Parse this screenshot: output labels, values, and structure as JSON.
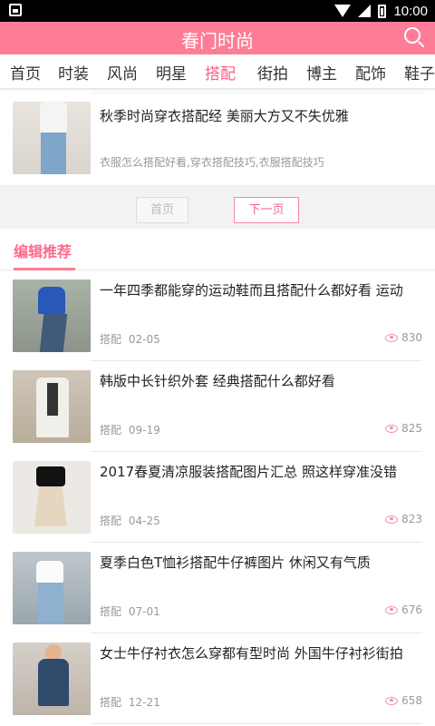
{
  "status_bar": {
    "time": "10:00"
  },
  "app": {
    "title": "春门时尚"
  },
  "nav_tabs": [
    {
      "label": "首页",
      "active": false
    },
    {
      "label": "时装",
      "active": false
    },
    {
      "label": "风尚",
      "active": false
    },
    {
      "label": "明星",
      "active": false
    },
    {
      "label": "搭配",
      "active": true
    },
    {
      "label": "街拍",
      "active": false
    },
    {
      "label": "博主",
      "active": false
    },
    {
      "label": "配饰",
      "active": false
    },
    {
      "label": "鞋子",
      "active": false
    }
  ],
  "top_article": {
    "title": "秋季时尚穿衣搭配经 美丽大方又不失优雅",
    "description": "衣服怎么搭配好看,穿衣搭配技巧,衣服搭配技巧"
  },
  "pager": {
    "first_label": "首页",
    "next_label": "下一页"
  },
  "recommend": {
    "heading": "编辑推荐",
    "items": [
      {
        "title": "一年四季都能穿的运动鞋而且搭配什么都好看 运动",
        "category": "搭配",
        "date": "02-05",
        "views": "830"
      },
      {
        "title": "韩版中长针织外套 经典搭配什么都好看",
        "category": "搭配",
        "date": "09-19",
        "views": "825"
      },
      {
        "title": "2017春夏清凉服装搭配图片汇总 照这样穿准没错",
        "category": "搭配",
        "date": "04-25",
        "views": "823"
      },
      {
        "title": "夏季白色T恤衫搭配牛仔裤图片 休闲又有气质",
        "category": "搭配",
        "date": "07-01",
        "views": "676"
      },
      {
        "title": "女士牛仔衬衣怎么穿都有型时尚 外国牛仔衬衫街拍",
        "category": "搭配",
        "date": "12-21",
        "views": "658"
      }
    ]
  },
  "colors": {
    "brand": "#fe7c96",
    "active_tab": "#fe5f86",
    "status_bar": "#000000"
  }
}
